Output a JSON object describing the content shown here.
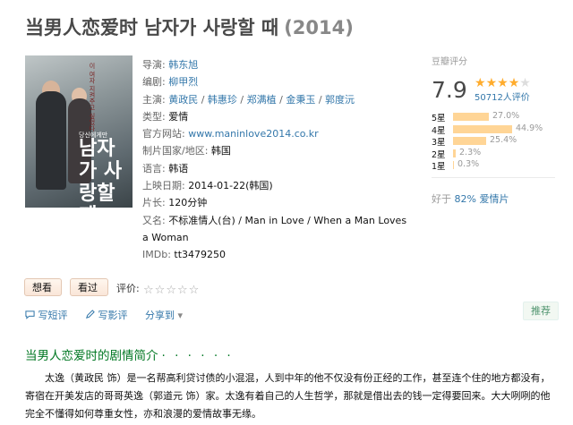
{
  "title": {
    "name": "当男人恋爱时 남자가 사랑할 때",
    "year": "(2014)"
  },
  "poster": {
    "tagline": "이 여자 지켜주고 싶었다",
    "korean_title": "남자가 사랑할 때",
    "small_text": "당신에게만"
  },
  "info": {
    "director_label": "导演:",
    "director": "韩东旭",
    "writer_label": "编剧:",
    "writer": "柳甲烈",
    "cast_label": "主演:",
    "cast": [
      "黄政民",
      "韩惠珍",
      "郑满植",
      "金秉玉",
      "郭度沅"
    ],
    "cast_sep": " / ",
    "genre_label": "类型:",
    "genre": "爱情",
    "site_label": "官方网站:",
    "site": "www.maninlove2014.co.kr",
    "country_label": "制片国家/地区:",
    "country": "韩国",
    "language_label": "语言:",
    "language": "韩语",
    "release_label": "上映日期:",
    "release": "2014-01-22(韩国)",
    "runtime_label": "片长:",
    "runtime": "120分钟",
    "aka_label": "又名:",
    "aka": "不标准情人(台) / Man in Love / When a Man Loves a Woman",
    "imdb_label": "IMDb:",
    "imdb": "tt3479250"
  },
  "rating": {
    "label": "豆瓣评分",
    "score": "7.9",
    "stars_value": 4,
    "stars_max": 5,
    "count": "50712人评价",
    "distribution": [
      {
        "label": "5星",
        "percent": 27.0,
        "text": "27.0%"
      },
      {
        "label": "4星",
        "percent": 44.9,
        "text": "44.9%"
      },
      {
        "label": "3星",
        "percent": 25.4,
        "text": "25.4%"
      },
      {
        "label": "2星",
        "percent": 2.3,
        "text": "2.3%"
      },
      {
        "label": "1星",
        "percent": 0.3,
        "text": "0.3%"
      }
    ],
    "better_prefix": "好于",
    "better_pct": "82%",
    "better_genre": "爱情片"
  },
  "interest": {
    "want_label": "想看",
    "seen_label": "看过",
    "rate_label": "评价:",
    "rate_stars": [
      "☆",
      "☆",
      "☆",
      "☆",
      "☆"
    ]
  },
  "actions": {
    "write_review": "写短评",
    "write_long_review": "写影评",
    "share": "分享到",
    "share_arrow": "▾",
    "recommend": "推荐"
  },
  "summary": {
    "heading": "当男人恋爱时的剧情简介",
    "heading_dots": "· · · · · ·",
    "text": "太逸（黄政民 饰）是一名帮高利贷讨债的小混混，人到中年的他不仅没有份正经的工作，甚至连个住的地方都没有，寄宿在开美发店的哥哥英逸（郭道元 饰）家。太逸有着自己的人生哲学，那就是借出去的钱一定得要回来。大大咧咧的他完全不懂得如何尊重女性，亦和浪漫的爱情故事无缘。"
  },
  "colors": {
    "link": "#3377aa",
    "star": "#ffac2d",
    "bar": "#ffd596",
    "section": "#007722",
    "title": "#494949"
  }
}
